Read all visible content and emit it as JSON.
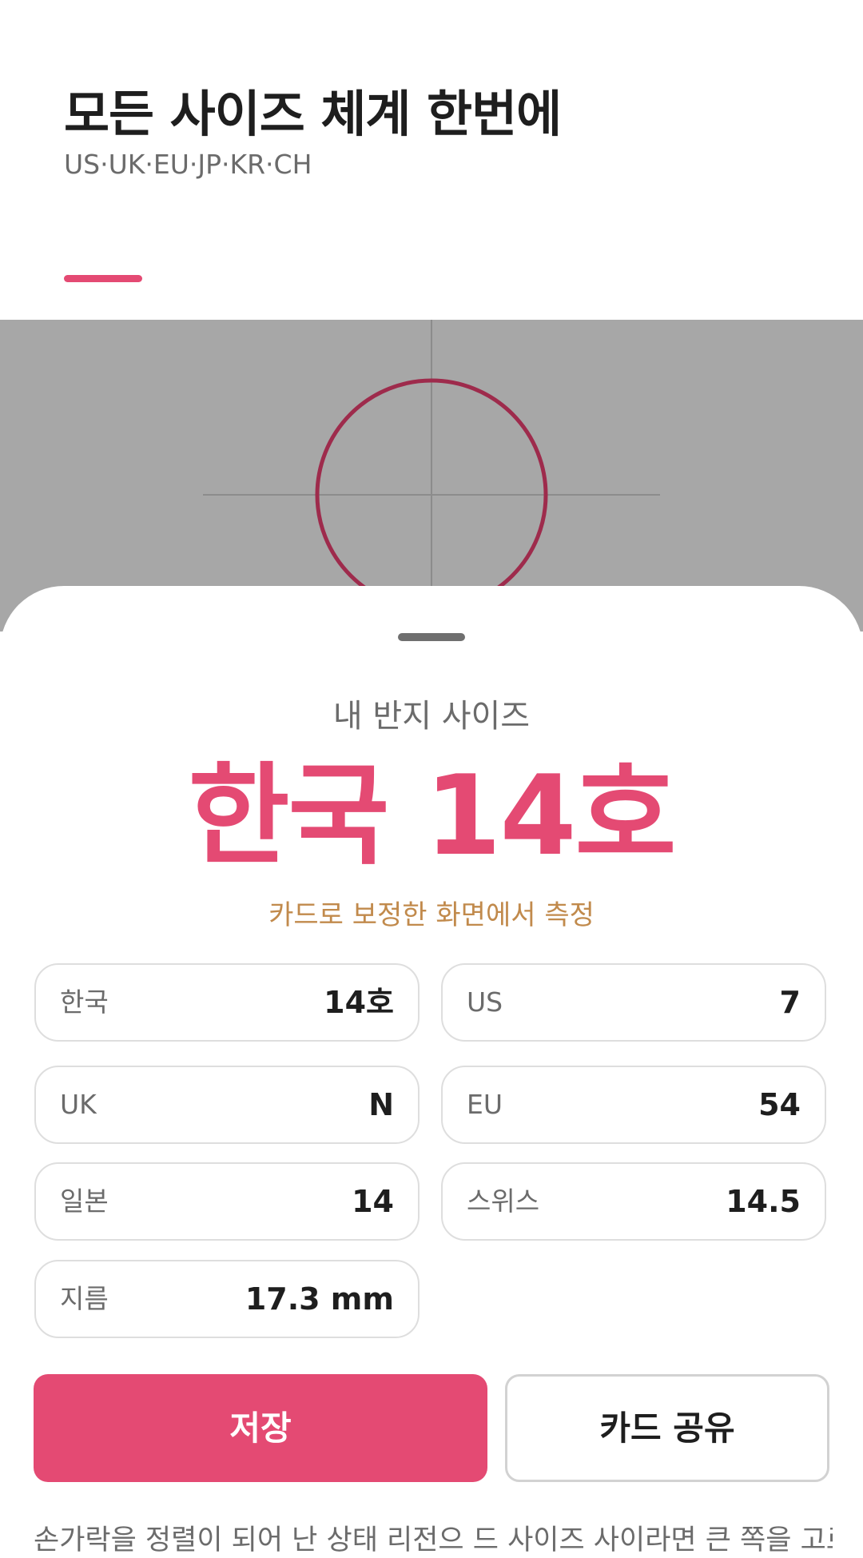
{
  "header": {
    "title": "모든 사이즈 체계 한번에",
    "subtitle": "US·UK·EU·JP·KR·CH"
  },
  "colors": {
    "accent": "#e44a73",
    "ring": "#9e2b4c",
    "camera_bg": "#a7a7a7",
    "note": "#c18a4c"
  },
  "sheet": {
    "label": "내 반지 사이즈",
    "main_size": "한국 14호",
    "calibration_note": "카드로 보정한 화면에서 측정",
    "sizes": [
      {
        "label": "한국",
        "value": "14호"
      },
      {
        "label": "US",
        "value": "7"
      },
      {
        "label": "UK",
        "value": "N"
      },
      {
        "label": "EU",
        "value": "54"
      },
      {
        "label": "일본",
        "value": "14"
      },
      {
        "label": "스위스",
        "value": "14.5"
      },
      {
        "label": "지름",
        "value": "17.3 mm"
      }
    ],
    "save_label": "저장",
    "share_label": "카드 공유",
    "tip": "손가락을 정렬이 되어 난 상태 리전으 드 사이즈 사이라면 큰 쪽을 고르"
  }
}
